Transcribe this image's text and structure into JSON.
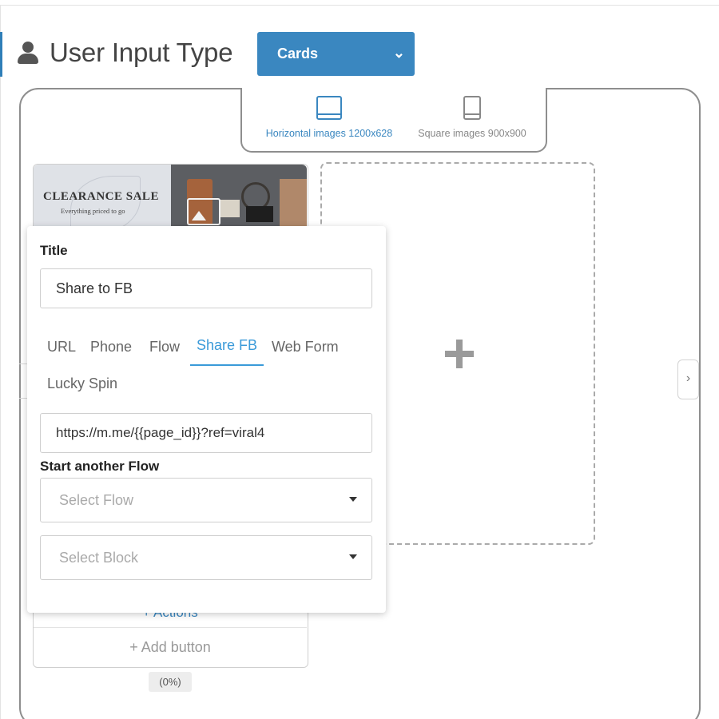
{
  "header": {
    "title": "User Input Type",
    "type_select_value": "Cards"
  },
  "format_toggle": {
    "horizontal_label": "Horizontal images 1200x628",
    "square_label": "Square images 900x900"
  },
  "card": {
    "image_text": {
      "title": "CLEARANCE SALE",
      "subtitle": "Everything priced to go"
    },
    "actions_label": "+ Actions",
    "add_button_label": "+ Add button",
    "percent_badge": "(0%)"
  },
  "editor": {
    "title_label": "Title",
    "title_value": "Share to FB",
    "tabs": [
      "URL",
      "Phone",
      "Flow",
      "Share FB",
      "Web Form",
      "Lucky Spin"
    ],
    "active_tab": "Share FB",
    "url_value": "https://m.me/{{page_id}}?ref=viral4",
    "start_flow_label": "Start another Flow",
    "select_flow_placeholder": "Select Flow",
    "select_block_placeholder": "Select Block"
  },
  "nav": {
    "next_arrow": "›"
  },
  "colors": {
    "accent": "#3a87c0",
    "active_tab": "#3a9ad9"
  },
  "icons": [
    "user-icon",
    "chevron-down-icon",
    "horizontal-image-icon",
    "square-image-icon",
    "image-upload-icon",
    "plus-icon",
    "caret-down-icon",
    "chevron-right-icon"
  ]
}
